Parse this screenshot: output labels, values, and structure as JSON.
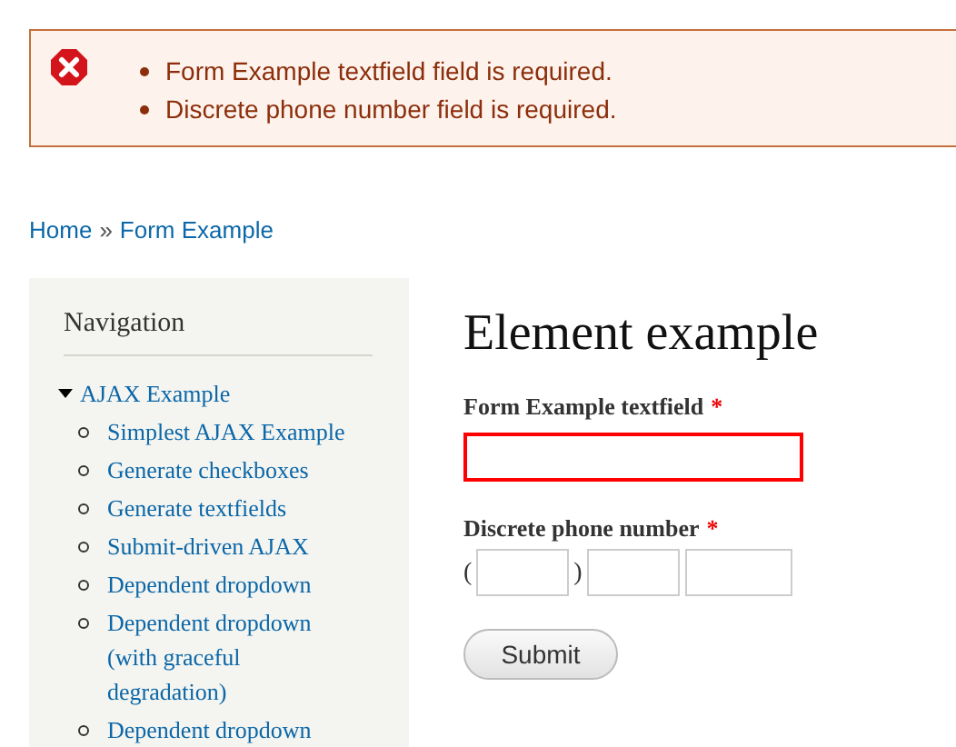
{
  "messages": {
    "kind": "error",
    "items": [
      "Form Example textfield field is required.",
      "Discrete phone number field is required."
    ]
  },
  "breadcrumb": {
    "items": [
      "Home",
      "Form Example"
    ],
    "separator": "»"
  },
  "sidebar": {
    "title": "Navigation",
    "items": [
      {
        "label": "AJAX Example",
        "expanded": true,
        "children": [
          {
            "label": "Simplest AJAX Example"
          },
          {
            "label": "Generate checkboxes"
          },
          {
            "label": "Generate textfields"
          },
          {
            "label": "Submit-driven AJAX"
          },
          {
            "label": "Dependent dropdown"
          },
          {
            "label": "Dependent dropdown (with graceful degradation)"
          },
          {
            "label": "Dependent dropdown"
          }
        ]
      }
    ]
  },
  "page_title": "Element example",
  "fields": [
    {
      "kind": "text",
      "label": "Form Example textfield",
      "required": "*",
      "error": true
    },
    {
      "kind": "phone",
      "label": "Discrete phone number",
      "required": "*",
      "open_paren": "(",
      "close_paren": ")",
      "error": false
    }
  ],
  "submit": "Submit"
}
